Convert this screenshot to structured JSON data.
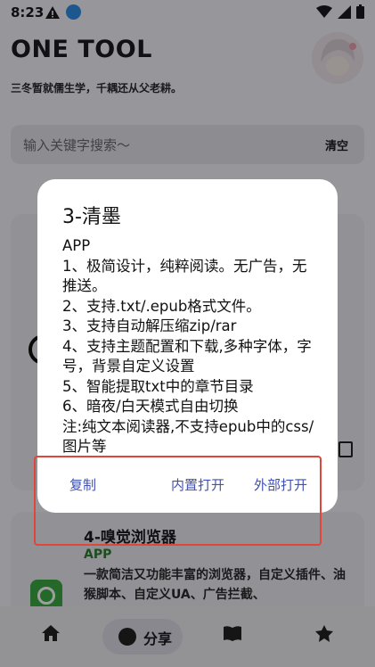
{
  "status_bar": {
    "time": "8:23"
  },
  "app": {
    "title": "ONE TOOL",
    "subtitle": "三冬暂就儒生学，千耦还从父老耕。"
  },
  "search": {
    "placeholder": "输入关键字搜索～",
    "clear_label": "清空"
  },
  "card2": {
    "title": "4-嗅觉浏览器",
    "tag": "APP",
    "description": "一款简洁又功能丰富的浏览器，自定义插件、油猴脚本、自定义UA、广告拦截、"
  },
  "bottom_nav": {
    "share_label": "分享"
  },
  "dialog": {
    "title": "3-清墨",
    "body": "APP\n1、极简设计，纯粹阅读。无广告，无推送。\n2、支持.txt/.epub格式文件。\n3、支持自动解压缩zip/rar\n4、支持主题配置和下载,多种字体，字号，背景自定义设置\n5、智能提取txt中的章节目录\n6、暗夜/白天模式自由切换\n注:纯文本阅读器,不支持epub中的css/图片等",
    "buttons": {
      "copy": "复制",
      "open_inner": "内置打开",
      "open_external": "外部打开"
    }
  },
  "colors": {
    "accent": "#3f51b5",
    "highlight_border": "#e0463a"
  }
}
